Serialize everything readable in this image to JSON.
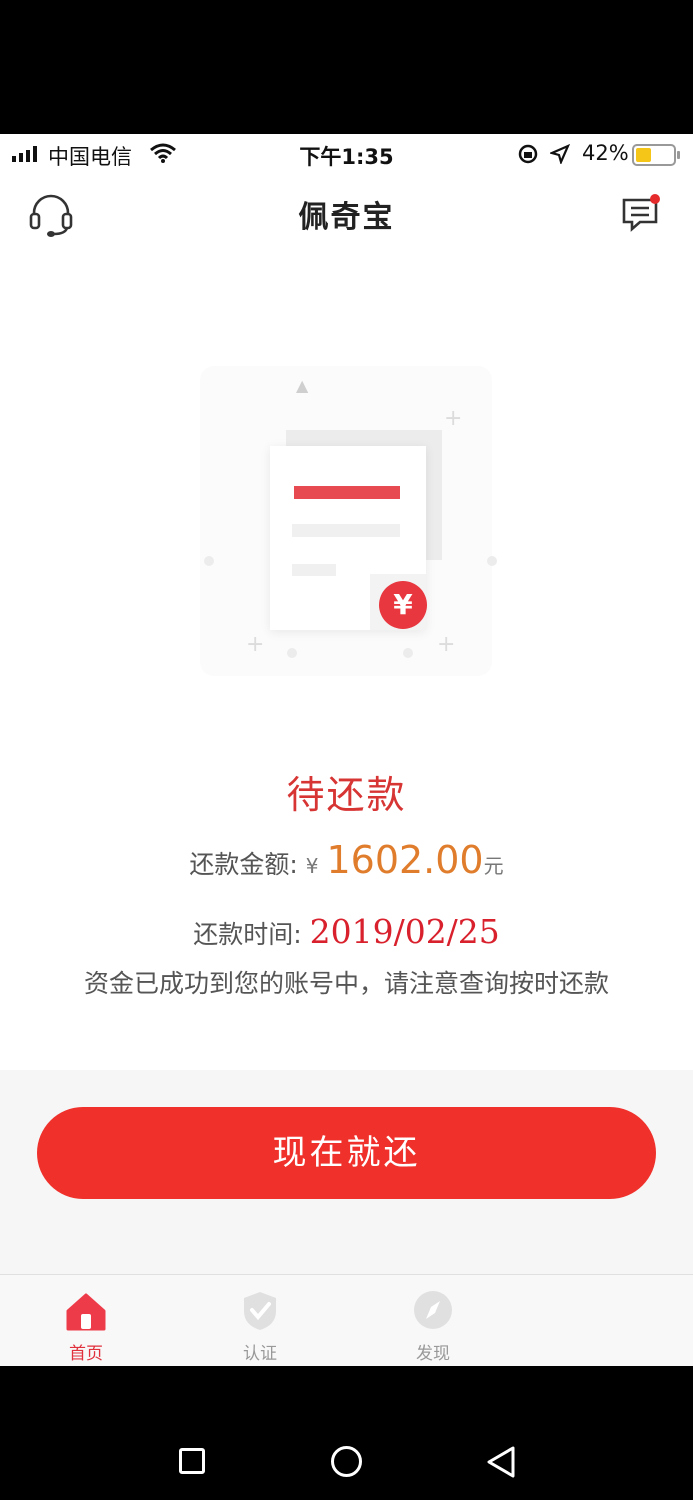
{
  "status_bar": {
    "carrier": "中国电信",
    "time": "下午1:35",
    "battery": "42%"
  },
  "header": {
    "title": "佩奇宝"
  },
  "loan": {
    "status": "待还款",
    "amount_label": "还款金额:",
    "currency_symbol": "¥",
    "amount": "1602.00",
    "amount_unit": "元",
    "date_label": "还款时间:",
    "date": "2019/02/25",
    "message": "资金已成功到您的账号中，请注意查询按时还款"
  },
  "illustration": {
    "coin_symbol": "¥"
  },
  "actions": {
    "pay_button": "现在就还"
  },
  "tabs": [
    {
      "label": "首页",
      "icon": "home-icon",
      "active": true
    },
    {
      "label": "认证",
      "icon": "shield-check-icon",
      "active": false
    },
    {
      "label": "发现",
      "icon": "compass-icon",
      "active": false
    }
  ],
  "colors": {
    "accent": "#f0302b",
    "status_red": "#d73434",
    "amount_orange": "#e07d2c",
    "battery_level": "#f5c518"
  },
  "battery_level": 0.42
}
